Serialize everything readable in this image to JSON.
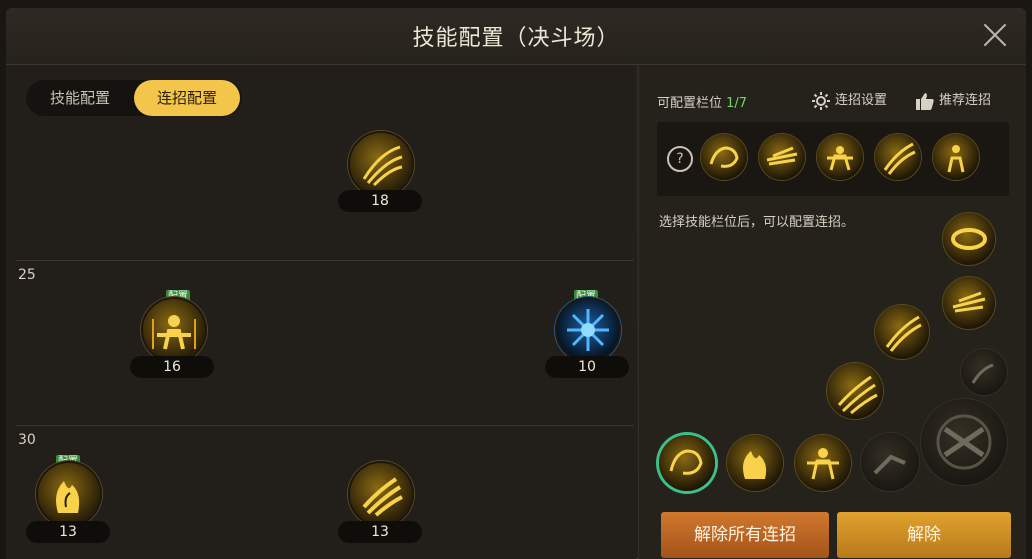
{
  "window": {
    "title": "技能配置（决斗场）"
  },
  "tabs": [
    {
      "label": "技能配置",
      "active": false
    },
    {
      "label": "连招配置",
      "active": true
    }
  ],
  "tree": {
    "levels": [
      "25",
      "30"
    ],
    "skills": [
      {
        "name": "slash-skill",
        "level": "18",
        "config": ""
      },
      {
        "name": "fist-aura-skill",
        "level": "16",
        "config": "配置"
      },
      {
        "name": "ice-burst-skill",
        "level": "10",
        "config": "配置"
      },
      {
        "name": "flame-hand-skill",
        "level": "13",
        "config": "配置"
      },
      {
        "name": "triple-claw-skill",
        "level": "13",
        "config": ""
      }
    ]
  },
  "combo": {
    "slots_label": "可配置栏位",
    "slots_value": "1/7",
    "settings_label": "连招设置",
    "recommend_label": "推荐连招",
    "help_symbol": "?",
    "hint": "选择技能栏位后，可以配置连招。"
  },
  "buttons": {
    "clear_all": "解除所有连招",
    "clear": "解除"
  },
  "colors": {
    "accent": "#f3c54a",
    "slot_value": "#6fd66f",
    "blue_skill": "#1d5fa0"
  }
}
